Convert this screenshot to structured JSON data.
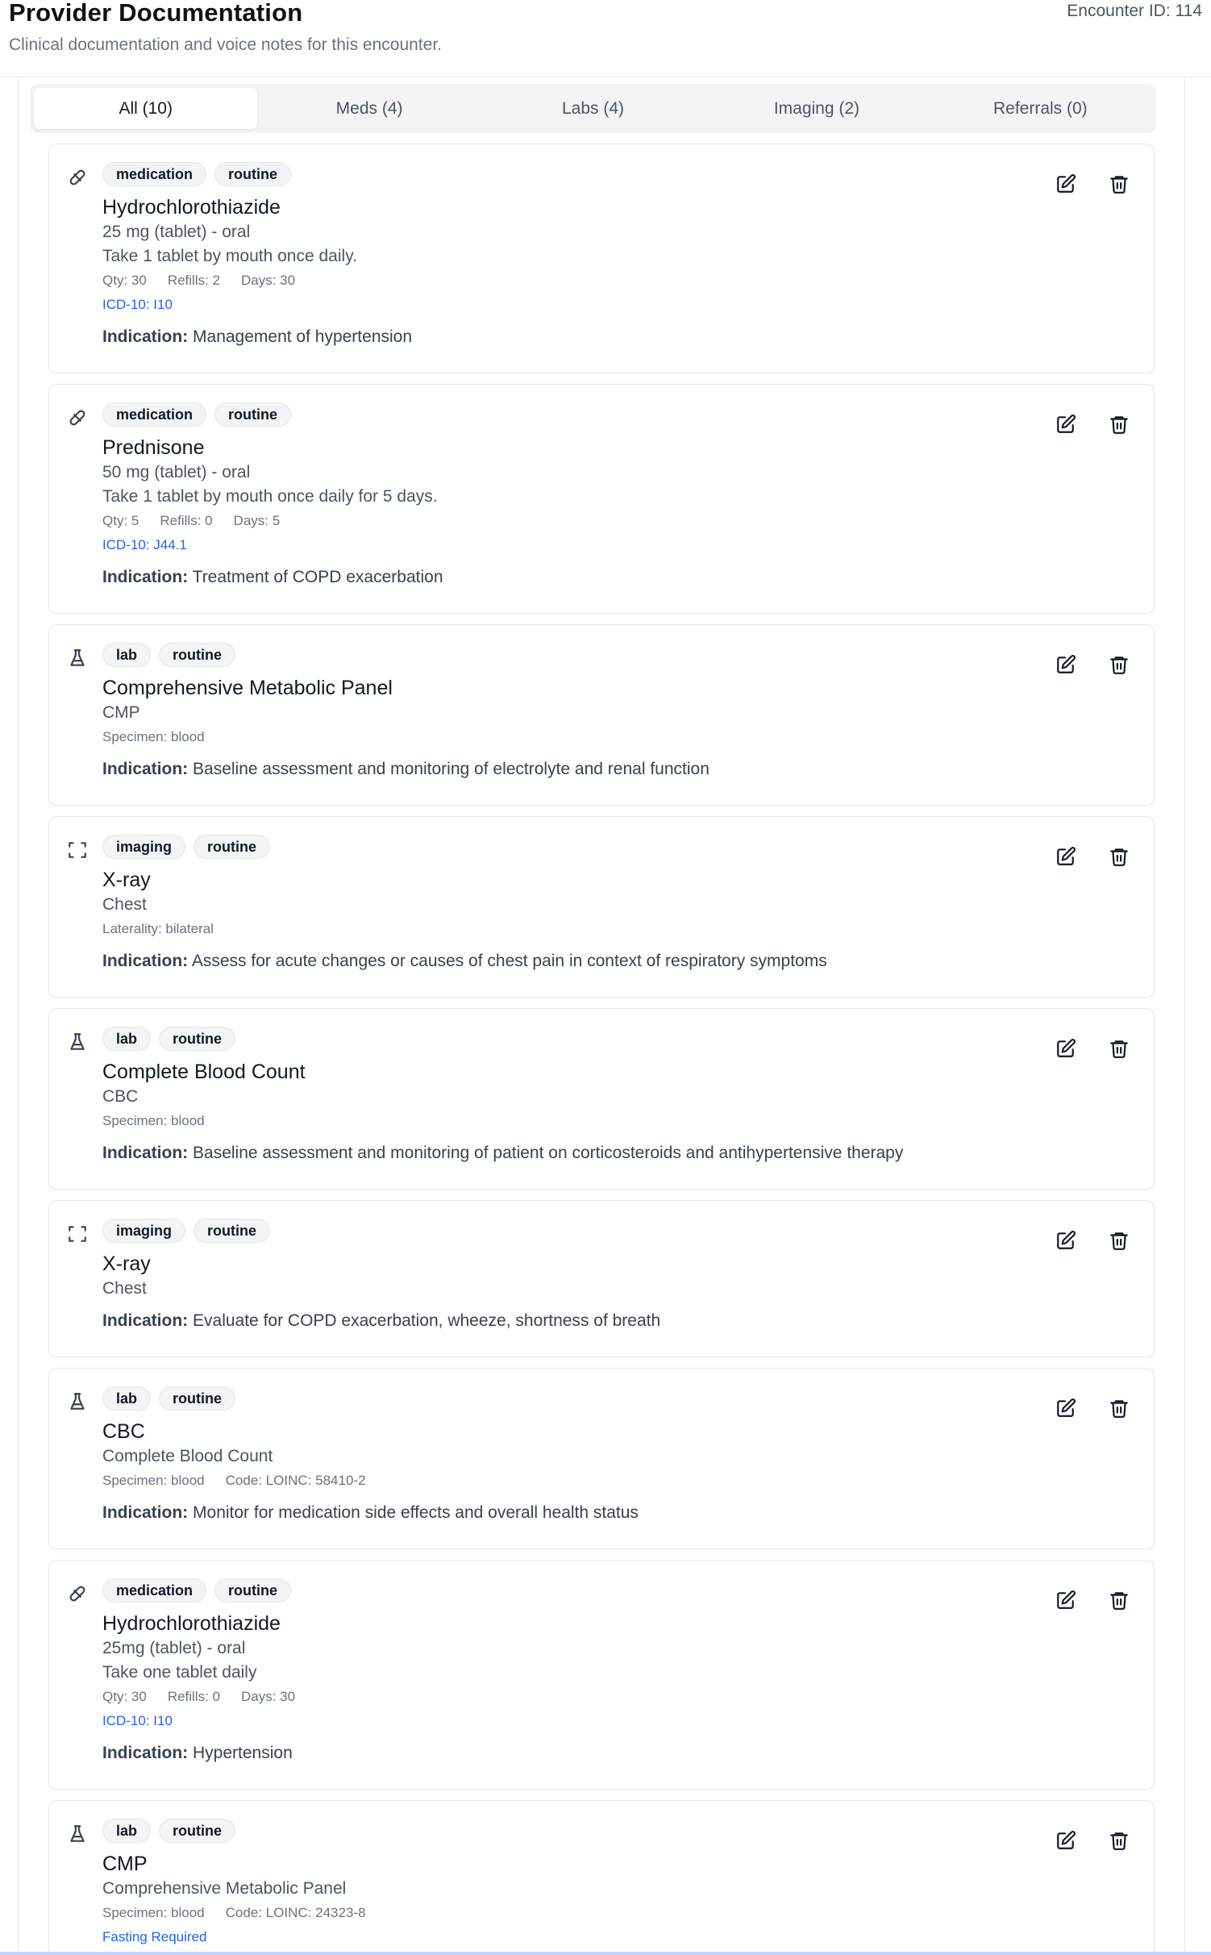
{
  "header": {
    "title": "Provider Documentation",
    "subtitle": "Clinical documentation and voice notes for this encounter.",
    "encounter": "Encounter ID: 114"
  },
  "tabs": [
    {
      "label": "All (10)",
      "active": true
    },
    {
      "label": "Meds (4)",
      "active": false
    },
    {
      "label": "Labs (4)",
      "active": false
    },
    {
      "label": "Imaging (2)",
      "active": false
    },
    {
      "label": "Referrals (0)",
      "active": false
    }
  ],
  "indication_label": "Indication:",
  "items": [
    {
      "type": "medication",
      "icon": "pill-icon",
      "priority": "routine",
      "title": "Hydrochlorothiazide",
      "line1": "25 mg (tablet) - oral",
      "line2": "Take 1 tablet by mouth once daily.",
      "meta": [
        "Qty: 30",
        "Refills: 2",
        "Days: 30"
      ],
      "code": "ICD-10: I10",
      "indication": "Management of hypertension"
    },
    {
      "type": "medication",
      "icon": "pill-icon",
      "priority": "routine",
      "title": "Prednisone",
      "line1": "50 mg (tablet) - oral",
      "line2": "Take 1 tablet by mouth once daily for 5 days.",
      "meta": [
        "Qty: 5",
        "Refills: 0",
        "Days: 5"
      ],
      "code": "ICD-10: J44.1",
      "indication": "Treatment of COPD exacerbation"
    },
    {
      "type": "lab",
      "icon": "flask-icon",
      "priority": "routine",
      "title": "Comprehensive Metabolic Panel",
      "line1": "CMP",
      "meta": [
        "Specimen: blood"
      ],
      "indication": "Baseline assessment and monitoring of electrolyte and renal function"
    },
    {
      "type": "imaging",
      "icon": "scan-icon",
      "priority": "routine",
      "title": "X-ray",
      "line1": "Chest",
      "meta": [
        "Laterality: bilateral"
      ],
      "indication": "Assess for acute changes or causes of chest pain in context of respiratory symptoms"
    },
    {
      "type": "lab",
      "icon": "flask-icon",
      "priority": "routine",
      "title": "Complete Blood Count",
      "line1": "CBC",
      "meta": [
        "Specimen: blood"
      ],
      "indication": "Baseline assessment and monitoring of patient on corticosteroids and antihypertensive therapy"
    },
    {
      "type": "imaging",
      "icon": "scan-icon",
      "priority": "routine",
      "title": "X-ray",
      "line1": "Chest",
      "indication": "Evaluate for COPD exacerbation, wheeze, shortness of breath"
    },
    {
      "type": "lab",
      "icon": "flask-icon",
      "priority": "routine",
      "title": "CBC",
      "line1": "Complete Blood Count",
      "meta": [
        "Specimen: blood",
        "Code: LOINC: 58410-2"
      ],
      "indication": "Monitor for medication side effects and overall health status"
    },
    {
      "type": "medication",
      "icon": "pill-icon",
      "priority": "routine",
      "title": "Hydrochlorothiazide",
      "line1": "25mg (tablet) - oral",
      "line2": "Take one tablet daily",
      "meta": [
        "Qty: 30",
        "Refills: 0",
        "Days: 30"
      ],
      "code": "ICD-10: I10",
      "indication": "Hypertension"
    },
    {
      "type": "lab",
      "icon": "flask-icon",
      "priority": "routine",
      "title": "CMP",
      "line1": "Comprehensive Metabolic Panel",
      "meta": [
        "Specimen: blood",
        "Code: LOINC: 24323-8"
      ],
      "code": "Fasting Required"
    }
  ],
  "colors": {
    "accent": "#2563eb",
    "border": "#e5e7eb",
    "badge_bg": "#f3f4f6"
  }
}
